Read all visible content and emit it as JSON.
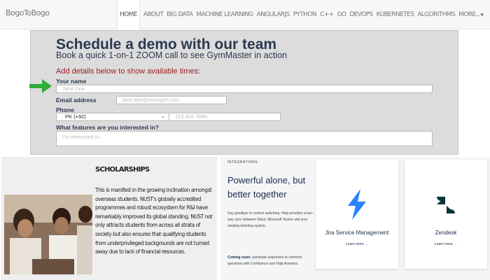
{
  "navbar": {
    "brand": "BogoToBogo",
    "items": [
      "HOME",
      "ABOUT",
      "BIG DATA",
      "MACHINE LEARNING",
      "ANGULARJS",
      "PYTHON",
      "C++",
      "GO",
      "DEVOPS",
      "KUBERNETES",
      "ALGORITHMS",
      "MORE..."
    ],
    "active_index": 0
  },
  "demo": {
    "title": "Schedule a demo with our team",
    "subtitle": "Book a quick 1-on-1 ZOOM call to see GymMaster in action",
    "add_details": "Add details below to show available times:",
    "name_label": "Your name",
    "name_placeholder": "Jane Doe",
    "email_label": "Email address",
    "email_placeholder": "jane.doe@example.com",
    "phone_label": "Phone",
    "phone_country": "PK (+92)",
    "phone_placeholder": "123 456 7890",
    "features_label": "What features are you interested in?",
    "features_placeholder": "I'm interested in..."
  },
  "scholarships": {
    "title": "SCHOLARSHIPS",
    "text": "This is manifest in the growing inclination amongst overseas students. NUST's globally accredited programmes and robust ecosystem for R&I have remarkably improved its global standing. NUST not only attracts students from across all strata of society but also ensures that qualifying students from underprivileged backgrounds are not turned away due to lack of financial resources."
  },
  "atlassian": {
    "eyebrow": "INTEGRATIONS",
    "heading": "Powerful alone, but better together",
    "body": "Say goodbye to context switching. Halp provides a two-way sync between Slack, Microsoft Teams and your existing ticketing system.",
    "soon_strong": "Coming soon:",
    "soon_text": " automate responses to common questions with Confluence and Halp Answers.",
    "cards": [
      {
        "name": "Jira Service Management",
        "link": "Learn more →",
        "icon": "jira-icon",
        "color": "#2684ff"
      },
      {
        "name": "Zendesk",
        "link": "Learn more →",
        "icon": "zendesk-icon",
        "color": "#03363d"
      }
    ]
  },
  "colors": {
    "demo_title": "#2b3950",
    "demo_add": "#9b1b1b",
    "arrow": "#2fae3c",
    "atlassian_heading": "#172b4d"
  }
}
